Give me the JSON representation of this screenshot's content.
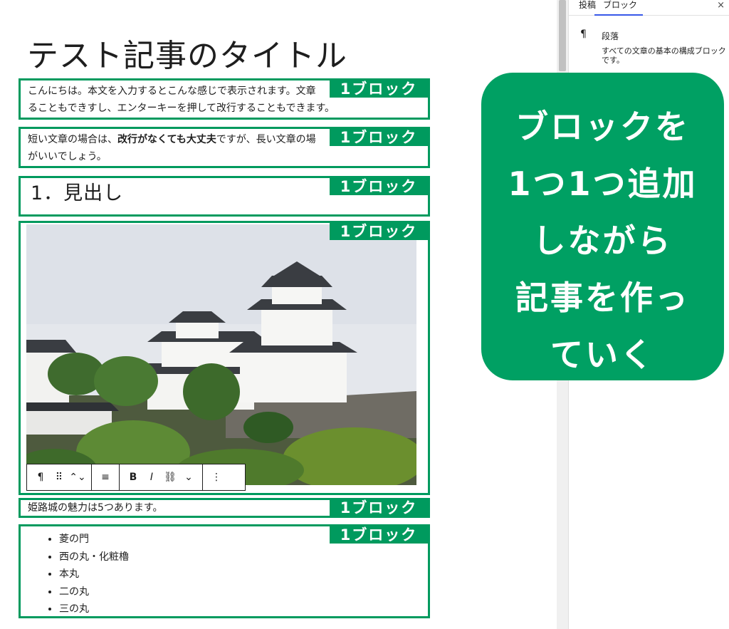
{
  "post": {
    "title": "テスト記事のタイトル"
  },
  "tag_label": "1ブロック",
  "blocks": {
    "p1": {
      "line1": "こんにちは。本文を入力するとこんな感じで表示されます。文章",
      "line2": "ることもできすし、エンターキーを押して改行することもできます。"
    },
    "p2": {
      "line1_pre": "短い文章の場合は、",
      "line1_bold": "改行がなくても大丈夫",
      "line1_post": "ですが、長い文章の場",
      "line2": "がいいでしょう。"
    },
    "heading": {
      "text": "1．見出し"
    },
    "p3": {
      "text": "姫路城の魅力は5つあります。"
    },
    "list": {
      "items": [
        "菱の門",
        "西の丸・化粧櫓",
        "本丸",
        "二の丸",
        "三の丸"
      ]
    }
  },
  "toolbar": {
    "paragraph_icon": "¶",
    "drag_icon": "⠿",
    "move_icon": "⌃⌄",
    "align_icon": "≡",
    "bold": "B",
    "italic": "I",
    "link_icon": "⛓",
    "more_icon": "⌄",
    "options_icon": "⋮"
  },
  "sidebar": {
    "tabs": [
      "投稿",
      "ブロック"
    ],
    "close": "×",
    "block_icon": "¶",
    "block_title": "段落",
    "block_desc": "すべての文章の基本の構成ブロックです。"
  },
  "callout": {
    "lines": [
      "ブロックを",
      "1つ1つ追加",
      "しながら",
      "記事を作っ",
      "ていく"
    ]
  },
  "colors": {
    "accent_green": "#009a5e",
    "callout_green": "#00a063",
    "wp_blue": "#3858e9"
  }
}
